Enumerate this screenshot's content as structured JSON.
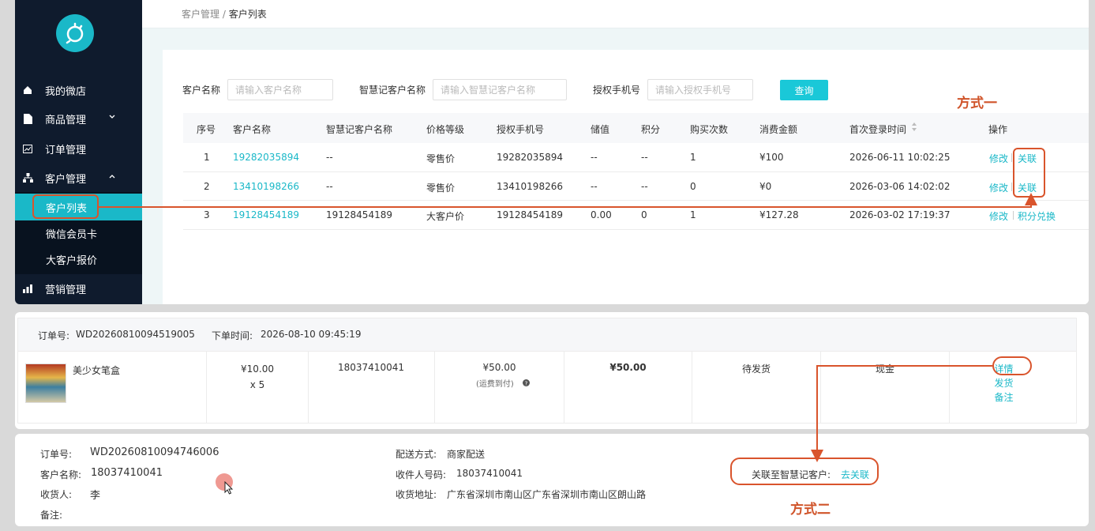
{
  "breadcrumb": {
    "parent": "客户管理",
    "separator": " / ",
    "current": "客户列表"
  },
  "sidebar": {
    "items": [
      {
        "label": "我的微店",
        "icon": "home-icon"
      },
      {
        "label": "商品管理",
        "icon": "document-icon",
        "expandable": true
      },
      {
        "label": "订单管理",
        "icon": "chart-icon"
      },
      {
        "label": "客户管理",
        "icon": "org-icon",
        "expanded": true
      },
      {
        "label": "营销管理",
        "icon": "bar-chart-icon"
      }
    ],
    "sub_items": [
      "客户列表",
      "微信会员卡",
      "大客户报价"
    ],
    "active_sub": "客户列表"
  },
  "filters": {
    "name_label": "客户名称",
    "name_placeholder": "请输入客户名称",
    "zhj_label": "智慧记客户名称",
    "zhj_placeholder": "请输入智慧记客户名称",
    "phone_label": "授权手机号",
    "phone_placeholder": "请输入授权手机号",
    "query_label": "查询"
  },
  "table": {
    "headers": [
      "序号",
      "客户名称",
      "智慧记客户名称",
      "价格等级",
      "授权手机号",
      "储值",
      "积分",
      "购买次数",
      "消费金额",
      "首次登录时间",
      "操作"
    ],
    "sort_icon": "sort-icon",
    "rows": [
      {
        "idx": "1",
        "name": "19282035894",
        "zhj": "--",
        "level": "零售价",
        "phone": "19282035894",
        "stored": "--",
        "points": "--",
        "count": "1",
        "amount": "¥100",
        "time": "2026-06-11 10:02:25",
        "op1": "修改",
        "op2": "关联"
      },
      {
        "idx": "2",
        "name": "13410198266",
        "zhj": "--",
        "level": "零售价",
        "phone": "13410198266",
        "stored": "--",
        "points": "--",
        "count": "0",
        "amount": "¥0",
        "time": "2026-03-06 14:02:02",
        "op1": "修改",
        "op2": "关联"
      },
      {
        "idx": "3",
        "name": "19128454189",
        "zhj": "19128454189",
        "level": "大客户价",
        "phone": "19128454189",
        "stored": "0.00",
        "points": "0",
        "count": "1",
        "amount": "¥127.28",
        "time": "2026-03-02 17:19:37",
        "op1": "修改",
        "op2": "积分兑换"
      }
    ]
  },
  "annotations": {
    "method1": "方式一",
    "method2": "方式二"
  },
  "order": {
    "no_label": "订单号:",
    "no": "WD20260810094519005",
    "time_label": "下单时间:",
    "time": "2026-08-10 09:45:19",
    "product": "美少女笔盒",
    "price": "¥10.00",
    "qty": "x 5",
    "phone": "18037410041",
    "total": "¥50.00",
    "shipping_note": "(运费到付)",
    "pay_amount": "¥50.00",
    "status": "待发货",
    "payment": "现金",
    "actions": [
      "详情",
      "发货",
      "备注"
    ]
  },
  "detail": {
    "order_no_label": "订单号:",
    "order_no": "WD20260810094746006",
    "customer_label": "客户名称:",
    "customer": "18037410041",
    "receiver_label": "收货人:",
    "receiver": "李",
    "remark_label": "备注:",
    "delivery_label": "配送方式:",
    "delivery": "商家配送",
    "receiver_phone_label": "收件人号码:",
    "receiver_phone": "18037410041",
    "address_label": "收货地址:",
    "address": "广东省深圳市南山区广东省深圳市南山区朗山路",
    "link_label": "关联至智慧记客户:",
    "link_action": "去关联"
  },
  "colors": {
    "accent": "#1ab8c8",
    "sidebar": "#0f1b2d",
    "annotation": "#d9542c"
  }
}
